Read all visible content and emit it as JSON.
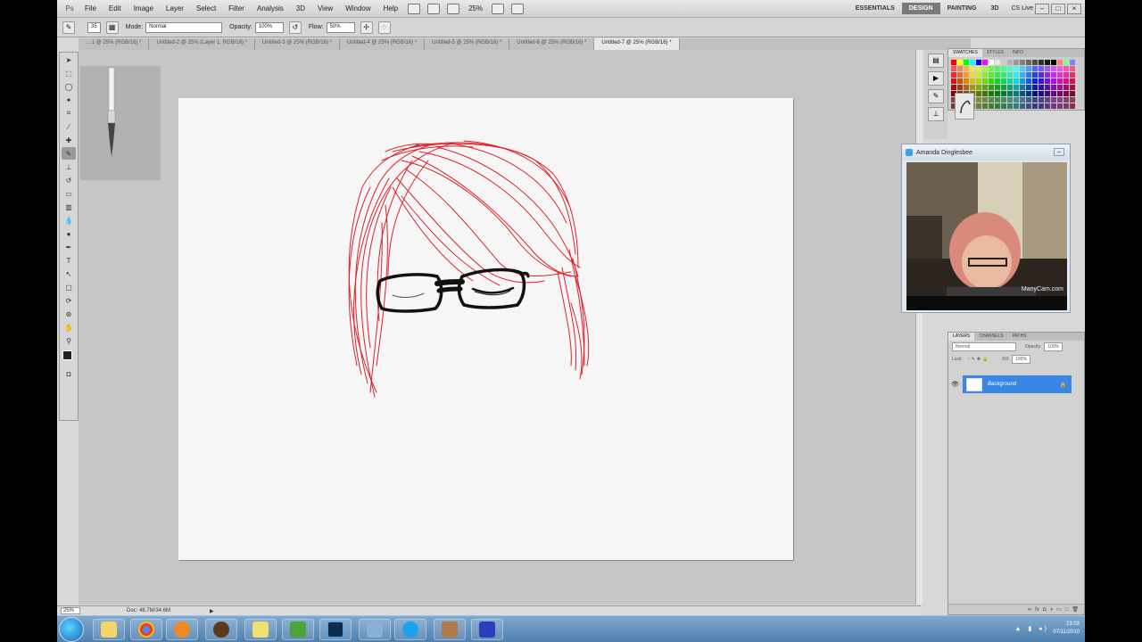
{
  "menubar": {
    "app_logo": "Ps",
    "items": [
      "File",
      "Edit",
      "Image",
      "Layer",
      "Select",
      "Filter",
      "Analysis",
      "3D",
      "View",
      "Window",
      "Help"
    ],
    "zoom": "25%",
    "workspaces": [
      "ESSENTIALS",
      "DESIGN",
      "PAINTING",
      "3D"
    ],
    "active_workspace": "DESIGN",
    "cslive": "CS Live"
  },
  "options": {
    "brush_size": "35",
    "mode_label": "Mode:",
    "mode_value": "Normal",
    "opacity_label": "Opacity:",
    "opacity_value": "100%",
    "flow_label": "Flow:",
    "flow_value": "50%"
  },
  "tabs": [
    "... 1 @ 25% (RGB/16) *",
    "Untitled-2 @ 25% (Layer 1, RGB/16) *",
    "Untitled-3 @ 25% (RGB/16) *",
    "Untitled-4 @ 25% (RGB/16) *",
    "Untitled-5 @ 25% (RGB/16) *",
    "Untitled-6 @ 25% (RGB/16) *",
    "Untitled-7 @ 25% (RGB/16) *"
  ],
  "active_tab": 6,
  "status": {
    "zoom": "25%",
    "doc": "Doc: 48.7M/34.6M"
  },
  "swatches_panel": {
    "tabs": [
      "SWATCHES",
      "STYLES",
      "INFO"
    ]
  },
  "webcam": {
    "title": "Amanda Dinglesbee",
    "watermark": "ManyCam.com"
  },
  "layers_panel": {
    "tabs": [
      "LAYERS",
      "CHANNELS",
      "PATHS"
    ],
    "blend_mode": "Normal",
    "opacity_label": "Opacity:",
    "opacity_value": "100%",
    "lock_label": "Lock:",
    "fill_label": "Fill:",
    "fill_value": "100%",
    "layer_name": "Background"
  },
  "taskbar": {
    "time": "23:03",
    "date": "07/11/2010"
  },
  "colors": {
    "hair_stroke": "#e0202a",
    "glasses_stroke": "#111111",
    "active_layer": "#3a86e6"
  }
}
